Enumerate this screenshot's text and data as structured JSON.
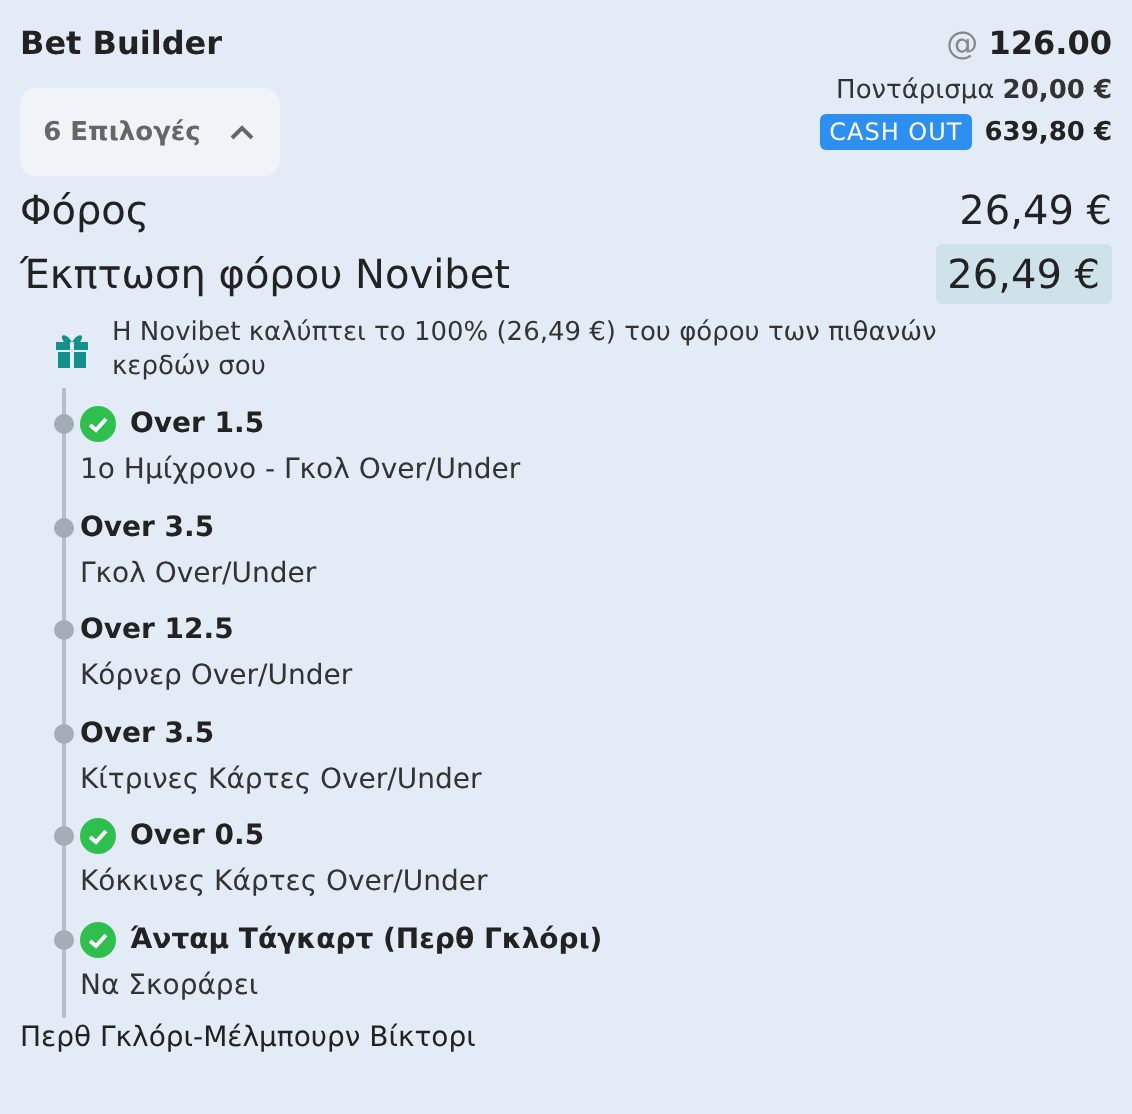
{
  "title": "Bet Builder",
  "odds": "@ **126.00**",
  "selections_toggle": {
    "label": "6 Επιλογές",
    "expanded": true
  },
  "stake": "Ποντάρισμα **20,00 €**",
  "cash_out": {
    "label": "CASH OUT",
    "amount": "639,80 €"
  },
  "tax": {
    "label": "Φόρος",
    "value": "26,49 €"
  },
  "tax_discount": {
    "label": "Έκπτωση φόρου Novibet",
    "value": "26,49 €"
  },
  "info": "Η Novibet καλύπτει το 100% (26,49 €) του φόρου των πιθανών κερδών σου",
  "legs": [
    {
      "pick": "Over 1.5",
      "market": "1ο Ημίχρονο - Γκολ Over/Under",
      "won": true
    },
    {
      "pick": "Over 3.5",
      "market": "Γκολ Over/Under",
      "won": false
    },
    {
      "pick": "Over 12.5",
      "market": "Κόρνερ Over/Under",
      "won": false
    },
    {
      "pick": "Over 3.5",
      "market": "Κίτρινες Κάρτες Over/Under",
      "won": false
    },
    {
      "pick": "Over 0.5",
      "market": "Κόκκινες Κάρτες Over/Under",
      "won": true
    },
    {
      "pick": "Άνταμ Τάγκαρτ (Περθ Γκλόρι)",
      "market": "Να Σκοράρει",
      "won": true
    }
  ],
  "match": "Περθ Γκλόρι-Μέλμπουρν Βίκτορι"
}
